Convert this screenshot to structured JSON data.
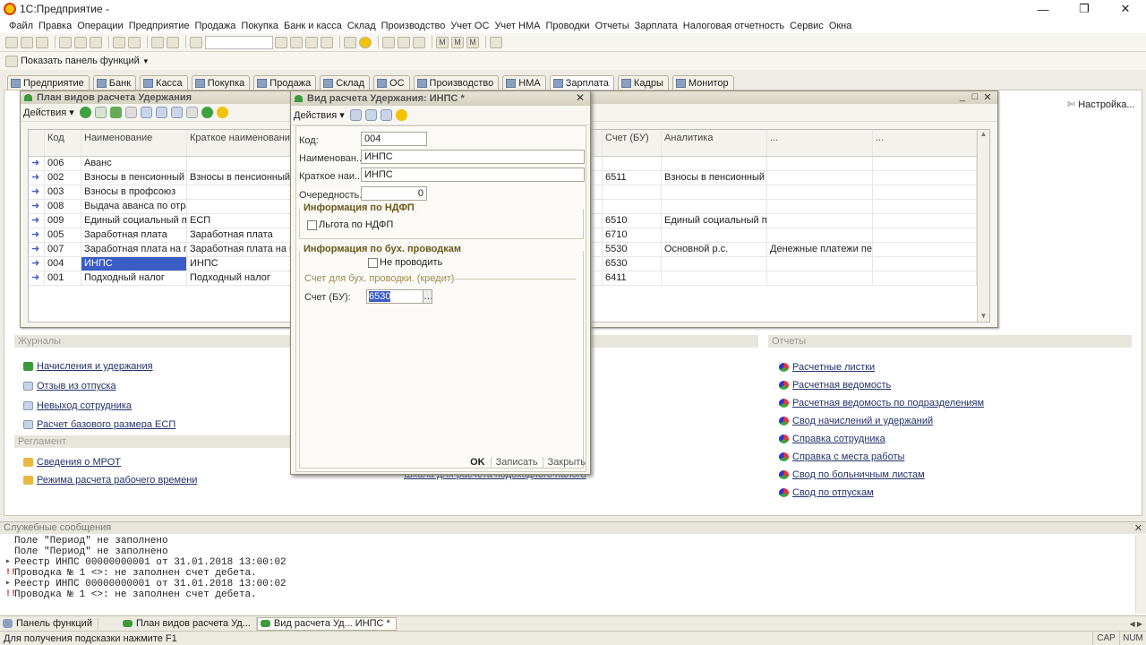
{
  "app": {
    "title": "1С:Предприятие -"
  },
  "menu": [
    "Файл",
    "Правка",
    "Операции",
    "Предприятие",
    "Продажа",
    "Покупка",
    "Банк и касса",
    "Склад",
    "Производство",
    "Учет ОС",
    "Учет НМА",
    "Проводки",
    "Отчеты",
    "Зарплата",
    "Налоговая отчетность",
    "Сервис",
    "Окна"
  ],
  "toolbar2": {
    "label": "Показать панель функций"
  },
  "tabs": [
    "Предприятие",
    "Банк",
    "Касса",
    "Покупка",
    "Продажа",
    "Склад",
    "ОС",
    "Производство",
    "НМА",
    "Зарплата",
    "Кадры",
    "Монитор"
  ],
  "settings_label": "Настройка...",
  "panel": {
    "journals_title": "Журналы",
    "journals": [
      "Начисления и удержания",
      "Отзыв из отпуска",
      "Невыход сотрудника",
      "Расчет базового размера ЕСП"
    ],
    "regl_title": "Регламент",
    "regl": [
      "Сведения о МРОТ",
      "Режима расчета рабочего времени"
    ],
    "hidden_link": "Шкала для расчета подоходного налога",
    "reports_title": "Отчеты",
    "reports": [
      "Расчетные листки",
      "Расчетная ведомость",
      "Расчетная ведомость по подразделениям",
      "Свод начислений и удержаний",
      "Справка сотрудника",
      "Справка с места работы",
      "Свод по больничным листам",
      "Свод по отпускам"
    ]
  },
  "plan_window": {
    "title": "План видов расчета Удержания",
    "actions_label": "Действия",
    "columns": [
      "Код",
      "Наименование",
      "Краткое наименование",
      "Счет (БУ)",
      "Аналитика",
      "...",
      "..."
    ],
    "rows": [
      {
        "code": "006",
        "name": "Аванс",
        "short": "",
        "acc": "",
        "an": "",
        "x1": ""
      },
      {
        "code": "002",
        "name": "Взносы в пенсионный ф...",
        "short": "Взносы в пенсионный ф...",
        "acc": "6511",
        "an": "Взносы в пенсионный ф...",
        "x1": ""
      },
      {
        "code": "003",
        "name": "Взносы в профсоюз",
        "short": "",
        "acc": "",
        "an": "",
        "x1": ""
      },
      {
        "code": "008",
        "name": "Выдача аванса по отра...",
        "short": "",
        "acc": "",
        "an": "",
        "x1": ""
      },
      {
        "code": "009",
        "name": "Единый социальный пл...",
        "short": "ЕСП",
        "acc": "6510",
        "an": "Единый социальный пл...",
        "x1": ""
      },
      {
        "code": "005",
        "name": "Заработная плата",
        "short": "Заработная плата",
        "acc": "6710",
        "an": "",
        "x1": ""
      },
      {
        "code": "007",
        "name": "Заработная плата на п...",
        "short": "Заработная плата на п...",
        "acc": "5530",
        "an": "Основной р.с.",
        "x1": "Денежные платежи пер..."
      },
      {
        "code": "004",
        "name": "ИНПС",
        "short": "ИНПС",
        "acc": "6530",
        "an": "",
        "x1": ""
      },
      {
        "code": "001",
        "name": "Подходный налог",
        "short": "Подходный налог",
        "acc": "6411",
        "an": "",
        "x1": ""
      }
    ]
  },
  "dialog": {
    "title": "Вид расчета Удержания: ИНПС *",
    "actions_label": "Действия",
    "code_label": "Код:",
    "code_value": "004",
    "name_label": "Наименован...",
    "name_value": "ИНПС",
    "short_label": "Краткое наи...",
    "short_value": "ИНПС",
    "order_label": "Очередность...",
    "order_value": "0",
    "ndfl_group": "Информация по НДФП",
    "ndfl_check": "Льгота по НДФП",
    "buh_group": "Информация по бух. проводкам",
    "no_post_check": "Не проводить",
    "credit_label": "Счет для бух. проводки. (кредит)",
    "acc_label": "Счет (БУ):",
    "acc_value": "6530",
    "ok": "OK",
    "save": "Записать",
    "close": "Закрыть"
  },
  "messages": {
    "title": "Служебные сообщения",
    "lines": [
      {
        "mark": "",
        "text": "Поле \"Период\" не заполнено"
      },
      {
        "mark": "",
        "text": "Поле \"Период\" не заполнено"
      },
      {
        "mark": "▸",
        "text": "Реестр ИНПС 00000000001 от 31.01.2018 13:00:02"
      },
      {
        "mark": "!!",
        "text": "Проводка № 1 <>: не заполнен счет дебета."
      },
      {
        "mark": "▸",
        "text": "Реестр ИНПС 00000000001 от 31.01.2018 13:00:02"
      },
      {
        "mark": "!!",
        "text": "Проводка № 1 <>: не заполнен счет дебета."
      }
    ]
  },
  "taskbar": [
    "Панель функций",
    "План видов расчета Уд...",
    "Вид расчета Уд... ИНПС *"
  ],
  "status": {
    "hint": "Для получения подсказки нажмите F1",
    "cap": "CAP",
    "num": "NUM"
  }
}
